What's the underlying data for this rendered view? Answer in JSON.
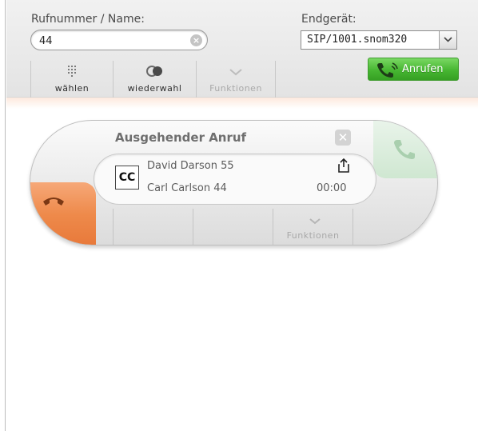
{
  "toolbar": {
    "number_label": "Rufnummer / Name:",
    "number_value": "44",
    "device_label": "Endgerät:",
    "device_value": "SIP/1001.snom320",
    "buttons": {
      "dial": "wählen",
      "redial": "wiederwahl",
      "functions": "Funktionen"
    },
    "call_button": "Anrufen"
  },
  "call": {
    "title": "Ausgehender Anruf",
    "badge": "CC",
    "caller": "David Darson 55",
    "callee": "Carl Carlson 44",
    "duration": "00:00",
    "functions": "Funktionen"
  },
  "icons": {
    "clear": "clear-icon",
    "dial": "keypad-icon",
    "redial": "redial-icon",
    "functions": "chevron-down-icon",
    "call": "phone-icon",
    "hangup": "hangup-icon",
    "accept": "accept-icon",
    "pin": "pin-icon",
    "share": "share-icon"
  },
  "colors": {
    "call_green": "#47b632",
    "hangup_orange": "#ee8a4b",
    "accept_green": "#cfe7d1"
  }
}
